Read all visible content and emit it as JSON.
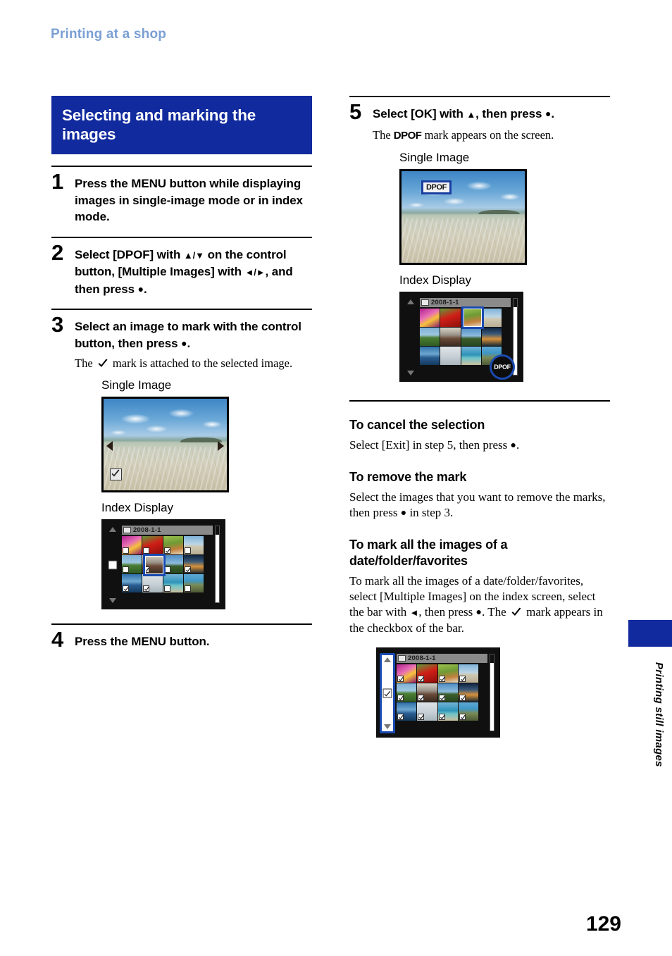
{
  "running_head": "Printing at a shop",
  "section": {
    "banner_title": "Selecting and marking the images"
  },
  "steps": [
    {
      "number": "1",
      "title": "Press the MENU button while displaying images in single-image mode or in index mode."
    },
    {
      "number": "2",
      "title_parts": {
        "a": "Select [DPOF] with ",
        "b": "▲/▼",
        "c": " on the control button, [Multiple Images] with ",
        "d": "◄/►",
        "e": ", and then press ",
        "f": "●",
        "g": "."
      }
    },
    {
      "number": "3",
      "title_parts": {
        "a": "Select an image to mark with the control button, then press ",
        "f": "●",
        "g": "."
      },
      "body_a": "The ",
      "body_b": " mark is attached to the selected image."
    },
    {
      "number": "4",
      "title": "Press the MENU button."
    },
    {
      "number": "5",
      "title_parts": {
        "a": "Select [OK] with ",
        "b": "▲",
        "c": ", then press ",
        "f": "●",
        "g": "."
      },
      "body_a": "The ",
      "body_dpof": "DPOF",
      "body_b": " mark appears on the screen."
    }
  ],
  "captions": {
    "single_image": "Single Image",
    "index_display": "Index Display"
  },
  "screens": {
    "index_date": "2008-1-1",
    "dpof_label": "DPOF",
    "dpof_round_label": "DPOF"
  },
  "subsections": [
    {
      "heading": "To cancel the selection",
      "body_a": "Select [Exit] in step 5, then press ",
      "body_circle": "●",
      "body_b": "."
    },
    {
      "heading": "To remove the mark",
      "body_a": "Select the images that you want to remove the marks, then press ",
      "body_circle": "●",
      "body_b": " in step 3."
    },
    {
      "heading": "To mark all the images of a date/folder/favorites",
      "body_a": "To mark all the images of a date/folder/favorites, select [Multiple Images] on the index screen, select the bar with ",
      "body_tri": "◄",
      "body_b": ", then press ",
      "body_circle": "●",
      "body_c": ". The ",
      "body_d": " mark appears in the checkbox of the bar."
    }
  ],
  "side_tab": {
    "label": "Printing still images"
  },
  "page_number": "129",
  "colors": {
    "banner_blue": "#112a9e",
    "running_head_blue": "#7a9fd4",
    "cursor_blue": "#1a4ab0"
  }
}
